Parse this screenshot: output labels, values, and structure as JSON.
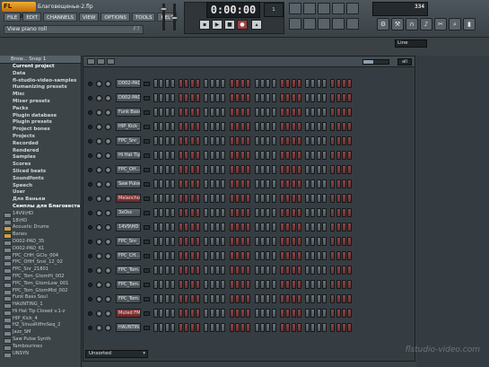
{
  "app": {
    "logo": "FL STUDIO",
    "project_title": "Благовещенье-2.flp",
    "hint": "View piano roll",
    "hint_key": "F7",
    "time_display": "0:00:00",
    "pattern_number": "1",
    "tempo": "334",
    "line_select": "Line"
  },
  "menu": [
    "FILE",
    "EDIT",
    "CHANNELS",
    "VIEW",
    "OPTIONS",
    "TOOLS",
    "HELP"
  ],
  "browser": {
    "header": "Brow... Snap 1",
    "categories": [
      "Current project",
      "Data",
      "fl-studio-video-samples",
      "Humanizing presets",
      "Misc",
      "Mixer presets",
      "Packs",
      "Plugin database",
      "Plugin presets",
      "Project bones",
      "Projects",
      "Recorded",
      "Rendered",
      "Samples",
      "Scores",
      "Sliced beats",
      "Soundfonts",
      "Speech",
      "User",
      "Для Ваньки",
      "Семплы для Благовеста"
    ],
    "files": [
      "14V9\\HD",
      "18\\HD",
      "Acoustic Drums",
      "Bones",
      "D002-PAD_35",
      "D002-PAD_61",
      "FPC_CHH_GClo_004",
      "FPC_OHH_Snsl_12_02",
      "FPC_Snr_21801",
      "FPC_Tom_GtomHi_002",
      "FPC_Tom_GtomLow_001",
      "FPC_Tom_GtomMid_002",
      "Funk Bass Soul",
      "HAUNTING_1",
      "Hi Hat Tip Closed v.1-z",
      "HIP_Kick_4",
      "HZ_SinusRiffmSeq_2",
      "Jazz_SM",
      "Saw Pulse Synth",
      "Tambourines",
      "UNSYN"
    ]
  },
  "sequencer": {
    "channels": [
      "D002-PAD",
      "D002-PAD",
      "Funk Bass...",
      "HIP_Kick_4",
      "FPC_Snr_...",
      "Hi Hat Tip...",
      "FPC_OH...",
      "Saw Pulse...",
      "Melancholy",
      "3xOsc",
      "14V9\\HD",
      "FPC_Snr_...",
      "FPC_CH...",
      "FPC_Tom...",
      "FPC_Tom...",
      "FPC_Tom...",
      "Muted FM",
      "HAUNTIN..."
    ],
    "red_channels": [
      8,
      16
    ],
    "group_filter": "Unsorted",
    "group_label": "all"
  },
  "watermark": "flstudio-video.com"
}
